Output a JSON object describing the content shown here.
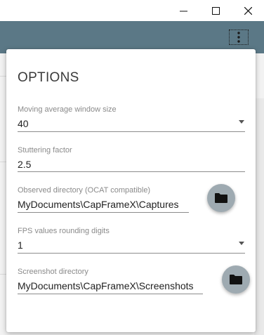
{
  "window": {
    "minimize_icon": "minimize-icon",
    "maximize_icon": "maximize-icon",
    "close_icon": "close-icon"
  },
  "appbar": {
    "color": "#5b7886",
    "menu_icon": "more-vertical-icon"
  },
  "options": {
    "title": "OPTIONS",
    "moving_average": {
      "label": "Moving average window size",
      "value": "40"
    },
    "stuttering_factor": {
      "label": "Stuttering factor",
      "value": "2.5"
    },
    "observed_directory": {
      "label": "Observed directory (OCAT compatible)",
      "value": "MyDocuments\\CapFrameX\\Captures",
      "button_icon": "folder-icon"
    },
    "fps_rounding": {
      "label": "FPS values rounding digits",
      "value": "1"
    },
    "screenshot_directory": {
      "label": "Screenshot directory",
      "value": "MyDocuments\\CapFrameX\\Screenshots",
      "button_icon": "folder-icon"
    }
  }
}
